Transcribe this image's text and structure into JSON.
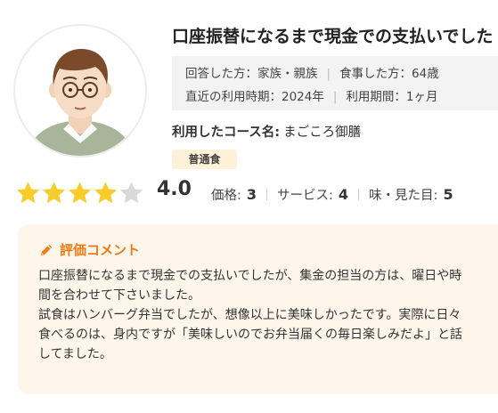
{
  "reviewer": {
    "avatar_icon": "man-with-glasses-avatar-icon"
  },
  "review": {
    "title": "口座振替になるまで現金での支払いでした",
    "info": {
      "respondent_label": "回答した方：家族・親族",
      "eater_label": "食事した方：64歳",
      "recent_use_label": "直近の利用時期：2024年",
      "period_label": "利用期間：1ヶ月"
    },
    "course_key": "利用したコース名:",
    "course_value": "まごころ御膳",
    "badge": "普通食",
    "rating": {
      "score": 4.0,
      "score_text": "4.0",
      "stars_filled": 4,
      "stars_total": 5,
      "price_label": "価格:",
      "price_value": "3",
      "service_label": "サービス:",
      "service_value": "4",
      "taste_label": "味・見た目:",
      "taste_value": "5"
    },
    "comment": {
      "heading": "評価コメント",
      "paragraph1": "口座振替になるまで現金での支払いでしたが、集金の担当の方は、曜日や時間を合わせて下さいました。",
      "paragraph2": "試食はハンバーグ弁当でしたが、想像以上に美味しかったです。実際に日々食べるのは、身内ですが「美味しいのでお弁当届くの毎日楽しみだよ」と話してました。"
    }
  },
  "colors": {
    "star_filled": "#f7cd2e",
    "star_empty": "#d9d9d9",
    "accent_orange": "#ef7a18",
    "comment_bg": "#fff6eb",
    "badge_bg": "#fff0d9",
    "info_bg": "#f3f3f3"
  },
  "icons": {
    "star": "star-icon",
    "comment": "pencil-icon"
  }
}
